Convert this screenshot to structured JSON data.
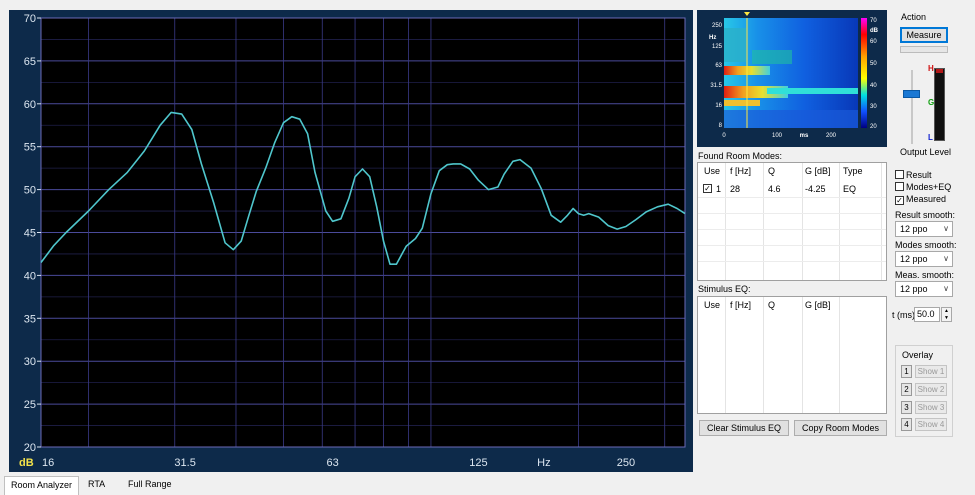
{
  "chart_data": {
    "type": "line",
    "ylabel": "dB",
    "xlabel": "Hz",
    "ylim": [
      20,
      70
    ],
    "yticks": [
      "70",
      "65",
      "60",
      "55",
      "50",
      "45",
      "40",
      "35",
      "30",
      "25",
      "20"
    ],
    "xscale": "log",
    "xlim": [
      16,
      330
    ],
    "xtick_labels": [
      "16",
      "31.5",
      "63",
      "125",
      "Hz",
      "250"
    ],
    "grid": true,
    "series": [
      {
        "color": "#4fc6cc",
        "x": [
          16,
          17,
          18,
          20,
          22,
          24,
          26,
          27,
          28,
          29.5,
          31,
          32.5,
          34,
          36,
          38,
          39.5,
          41,
          42.5,
          44,
          46,
          48,
          50,
          52,
          54,
          56,
          58,
          61,
          63,
          65.5,
          68,
          70,
          72.5,
          75,
          77.5,
          80,
          82.5,
          85,
          89,
          93,
          96,
          100,
          104,
          108,
          111,
          115,
          120,
          125,
          131,
          137,
          141,
          147,
          152,
          160,
          168,
          176,
          184,
          190,
          195,
          200,
          205,
          210,
          220,
          230,
          240,
          250,
          262,
          275,
          290,
          305,
          318,
          330
        ],
        "values": [
          41.5,
          43.5,
          45.0,
          47.5,
          50.0,
          52.0,
          54.5,
          56.0,
          57.5,
          59.0,
          58.8,
          57.0,
          53.0,
          48.5,
          43.8,
          43.0,
          44.0,
          47.0,
          49.8,
          52.5,
          55.5,
          57.8,
          58.5,
          58.2,
          56.5,
          52.0,
          47.5,
          46.3,
          46.6,
          49.0,
          51.5,
          52.4,
          51.5,
          48.0,
          44.0,
          41.3,
          41.3,
          43.4,
          44.3,
          45.5,
          49.5,
          52.2,
          52.9,
          53.0,
          53.0,
          52.4,
          51.1,
          50.0,
          50.3,
          51.8,
          53.3,
          53.5,
          52.5,
          50.1,
          47.0,
          46.2,
          47.0,
          47.8,
          47.2,
          47.0,
          47.2,
          46.8,
          45.8,
          45.4,
          45.7,
          46.5,
          47.4,
          48.0,
          48.3,
          47.8,
          47.2
        ]
      }
    ]
  },
  "spectrogram": {
    "y_unit": "Hz",
    "y_ticks": [
      "250",
      "125",
      "63",
      "31.5",
      "16",
      "8"
    ],
    "x_ticks": [
      "0",
      "100",
      "200"
    ],
    "x_unit": "ms",
    "colorbar_unit": "dB",
    "colorbar_ticks": [
      "70",
      "60",
      "50",
      "40",
      "30",
      "20"
    ]
  },
  "found_room_modes": {
    "label": "Found Room Modes:",
    "columns": [
      "Use",
      "f [Hz]",
      "Q",
      "G [dB]",
      "Type"
    ],
    "rows": [
      {
        "use_checked": true,
        "index": "1",
        "freq": "28",
        "q": "4.6",
        "gain": "-4.25",
        "type": "EQ"
      }
    ]
  },
  "stimulus_eq": {
    "label": "Stimulus EQ:",
    "columns": [
      "Use",
      "f [Hz]",
      "Q",
      "G [dB]"
    ]
  },
  "buttons": {
    "clear_stimulus": "Clear Stimulus EQ",
    "copy_room_modes": "Copy Room Modes"
  },
  "action": {
    "label": "Action",
    "measure_button": "Measure",
    "output_level_label": "Output Level",
    "meter_labels": {
      "high": "H",
      "green": "G",
      "low": "L"
    }
  },
  "display_options": {
    "result": {
      "label": "Result",
      "checked": false
    },
    "modes_eq": {
      "label": "Modes+EQ",
      "checked": false
    },
    "measured": {
      "label": "Measured",
      "checked": true
    },
    "result_smooth_label": "Result smooth:",
    "result_smooth_value": "12 ppo",
    "modes_smooth_label": "Modes smooth:",
    "modes_smooth_value": "12 ppo",
    "meas_smooth_label": "Meas. smooth:",
    "meas_smooth_value": "12 ppo",
    "t_label": "t (ms)",
    "t_value": "50.0"
  },
  "overlay": {
    "label": "Overlay",
    "items": [
      {
        "num": "1",
        "show": "Show 1"
      },
      {
        "num": "2",
        "show": "Show 2"
      },
      {
        "num": "3",
        "show": "Show 3"
      },
      {
        "num": "4",
        "show": "Show 4"
      }
    ]
  },
  "tabs": [
    {
      "label": "Room Analyzer",
      "active": true
    },
    {
      "label": "RTA",
      "active": false
    },
    {
      "label": "Full Range",
      "active": false
    }
  ]
}
